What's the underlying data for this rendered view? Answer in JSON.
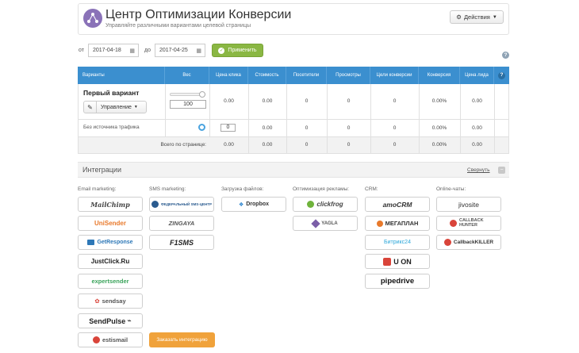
{
  "header": {
    "title": "Центр Оптимизации Конверсии",
    "subtitle": "Управляйте различными вариантами целевой страницы",
    "actions_label": "Действия"
  },
  "filter": {
    "from_label": "от",
    "from_value": "2017-04-18",
    "to_label": "до",
    "to_value": "2017-04-25",
    "apply_label": "Применить"
  },
  "table": {
    "columns": [
      "Варианты",
      "Вес",
      "Цена клика",
      "Стоимость",
      "Посетители",
      "Просмотры",
      "Цели конверсии",
      "Конверсия",
      "Цена лида"
    ],
    "variant_row": {
      "name": "Первый вариант",
      "manage_label": "Управление",
      "weight": "100",
      "values": [
        "0.00",
        "0.00",
        "0",
        "0",
        "0",
        "0.00%",
        "0.00"
      ]
    },
    "source_row": {
      "label": "Без источника трафика",
      "weight": "0",
      "values": [
        "0.00",
        "0.00",
        "0",
        "0",
        "0",
        "0.00%",
        "0.00"
      ]
    },
    "total_row": {
      "label": "Всего по странице:",
      "values": [
        "0.00",
        "0.00",
        "0",
        "0",
        "0",
        "0.00%",
        "0.00"
      ]
    }
  },
  "integrations": {
    "title": "Интеграции",
    "collapse_label": "Свернуть",
    "columns": [
      {
        "header": "Email marketing:",
        "items": [
          "MailChimp",
          "UniSender",
          "GetResponse",
          "JustClick.Ru",
          "expertsender",
          "sendsay",
          "SendPulse",
          "estismail"
        ]
      },
      {
        "header": "SMS marketing:",
        "items": [
          "ФЕДЕРАЛЬНЫЙ SMS-ЦЕНТР",
          "ZINGAYA",
          "F1SMS"
        ]
      },
      {
        "header": "Загрузка файлов:",
        "items": [
          "Dropbox"
        ]
      },
      {
        "header": "Оптимизация рекламы:",
        "items": [
          "clickfrog",
          "YAGLA"
        ]
      },
      {
        "header": "CRM:",
        "items": [
          "amoCRM",
          "МЕГАПЛАН",
          "Битрикс24",
          "U ON",
          "pipedrive"
        ]
      },
      {
        "header": "Online-чаты:",
        "items": [
          "jivosite",
          "CALLBACK HUNTER",
          "CallbackKILLER"
        ]
      }
    ],
    "order_label": "Заказать интеграцию"
  },
  "colors": {
    "accent": "#3b8fcf",
    "green": "#8ab743",
    "orange": "#f0a23b",
    "logo": "#8a72b8"
  }
}
